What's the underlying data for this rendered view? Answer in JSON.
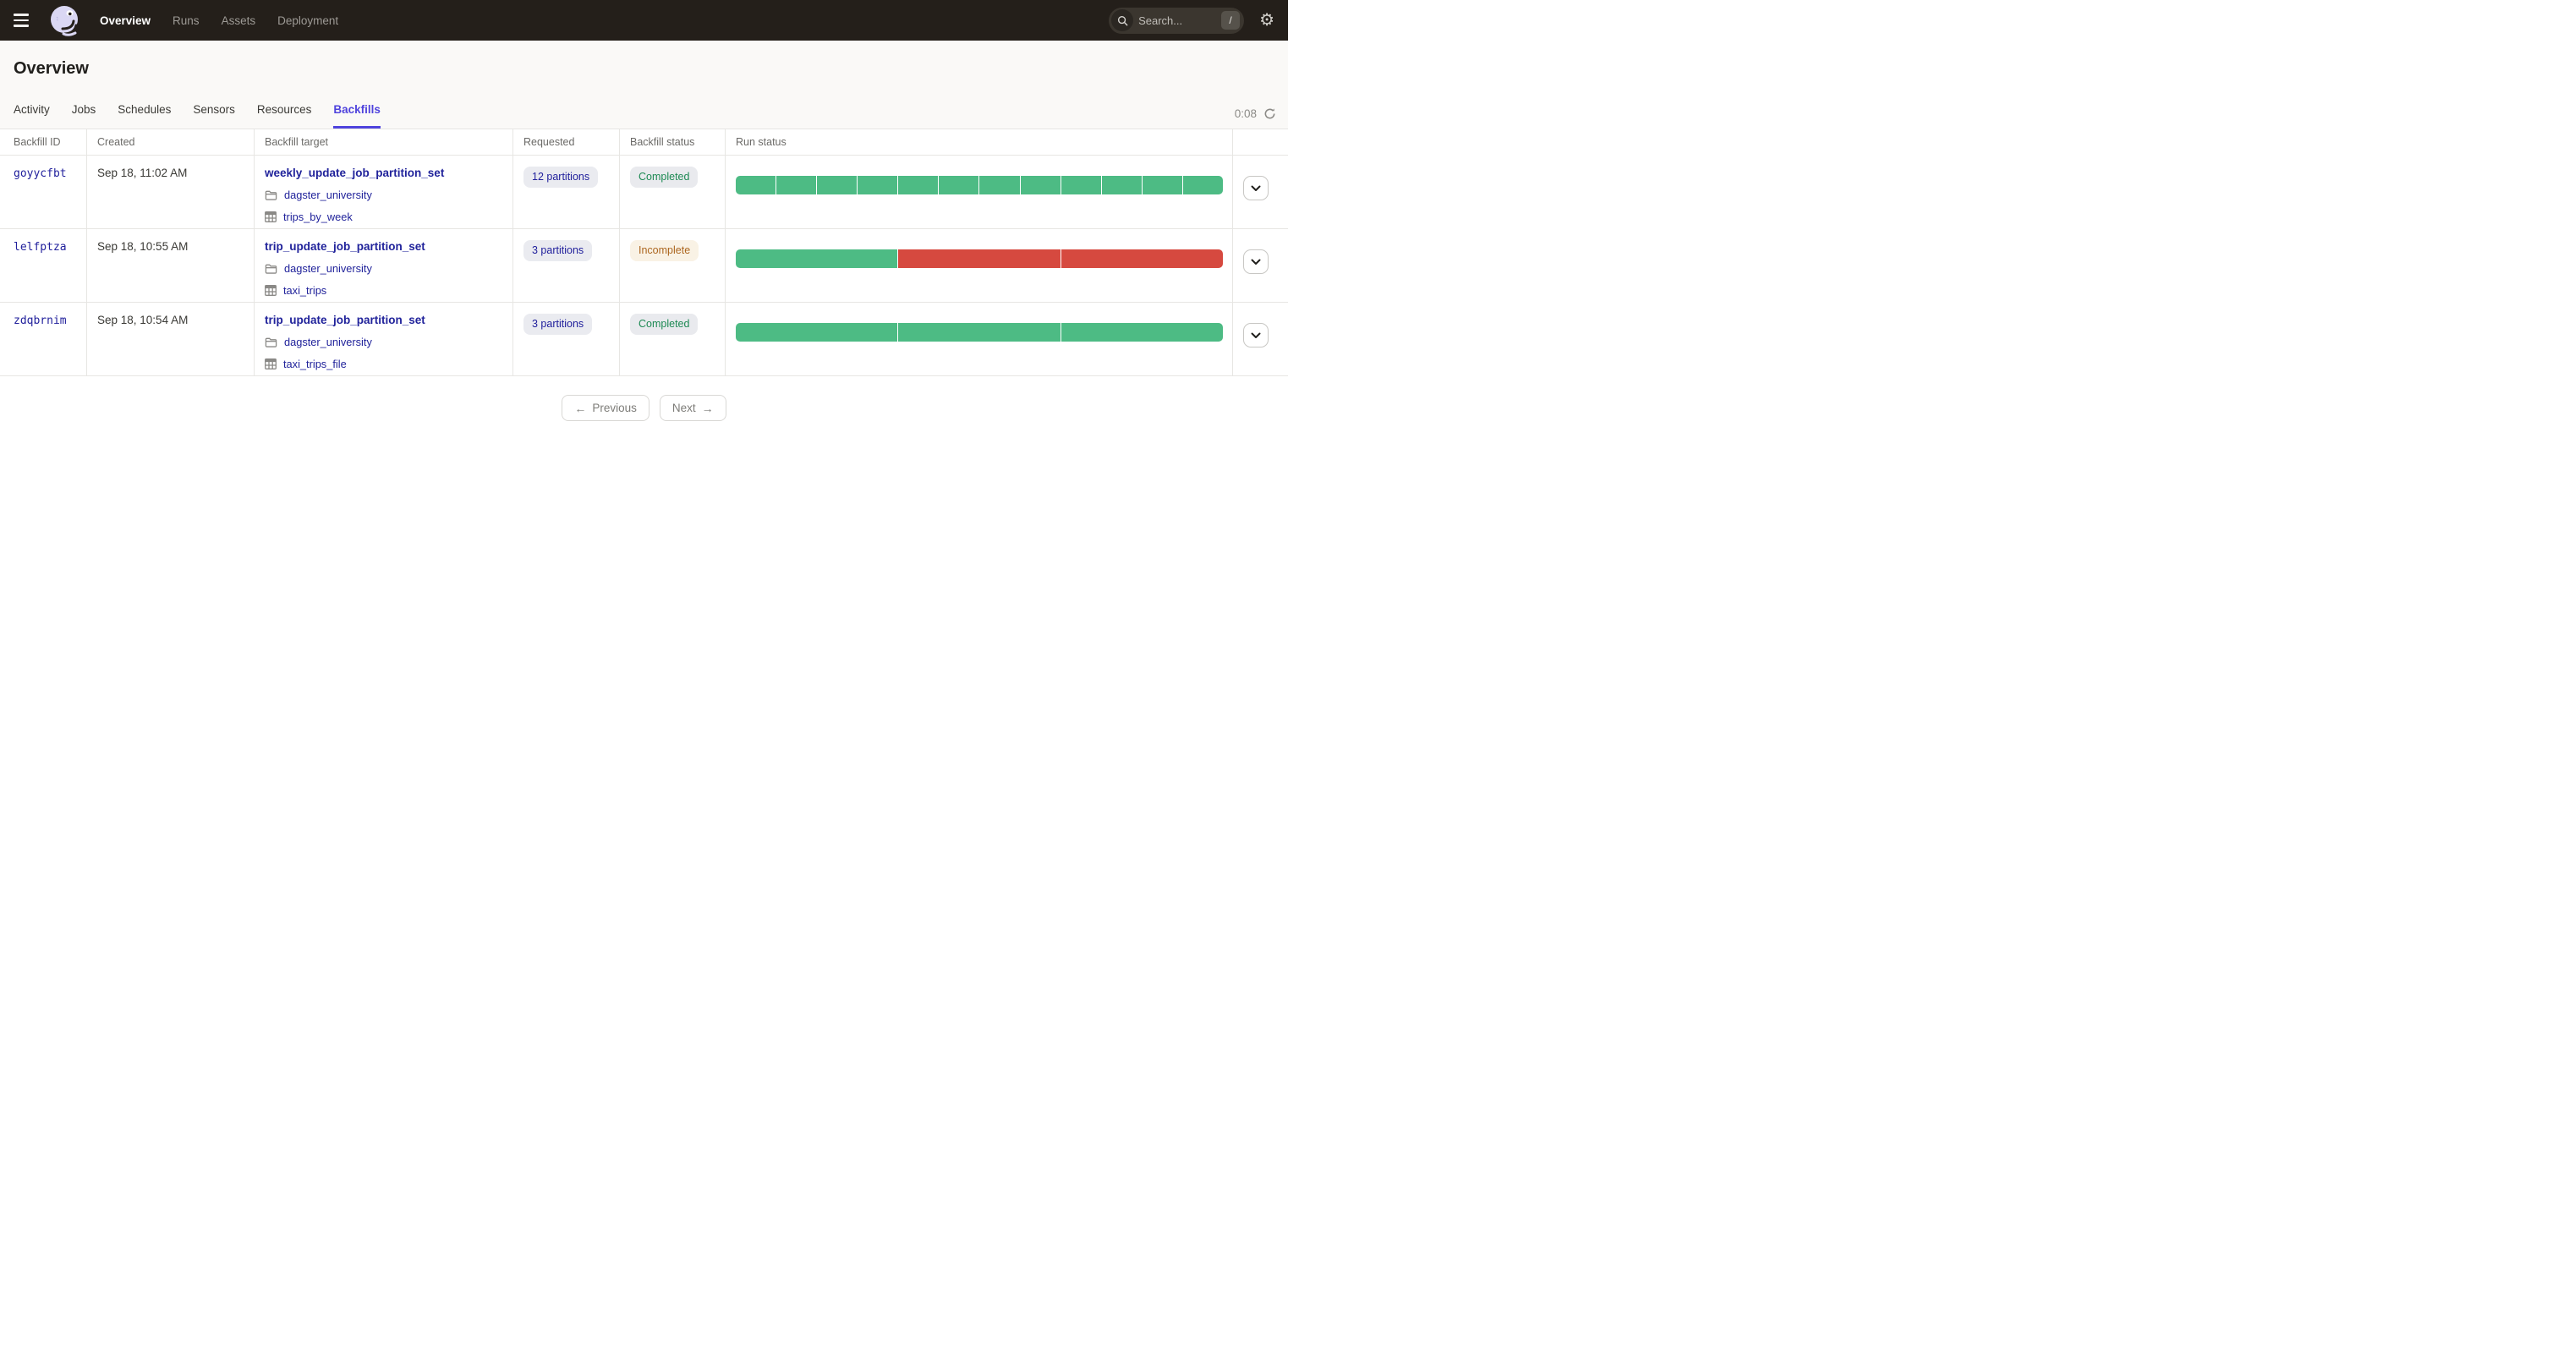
{
  "nav": {
    "logo_name": "dagster-logo",
    "items": [
      {
        "label": "Overview",
        "active": true
      },
      {
        "label": "Runs",
        "active": false
      },
      {
        "label": "Assets",
        "active": false
      },
      {
        "label": "Deployment",
        "active": false
      }
    ],
    "search": {
      "placeholder": "Search...",
      "shortcut": "/"
    }
  },
  "page": {
    "title": "Overview"
  },
  "tabs": {
    "items": [
      {
        "label": "Activity",
        "active": false
      },
      {
        "label": "Jobs",
        "active": false
      },
      {
        "label": "Schedules",
        "active": false
      },
      {
        "label": "Sensors",
        "active": false
      },
      {
        "label": "Resources",
        "active": false
      },
      {
        "label": "Backfills",
        "active": true
      }
    ],
    "refresh_timer": "0:08"
  },
  "table": {
    "columns": [
      "Backfill ID",
      "Created",
      "Backfill target",
      "Requested",
      "Backfill status",
      "Run status",
      ""
    ],
    "rows": [
      {
        "id": "goyycfbt",
        "created": "Sep 18, 11:02 AM",
        "target": "weekly_update_job_partition_set",
        "tags": [
          {
            "icon": "folder-icon",
            "label": "dagster_university"
          },
          {
            "icon": "table-grid-icon",
            "label": "trips_by_week"
          }
        ],
        "requested": "12 partitions",
        "status": {
          "label": "Completed",
          "tone": "success"
        },
        "run_segments": [
          "success",
          "success",
          "success",
          "success",
          "success",
          "success",
          "success",
          "success",
          "success",
          "success",
          "success",
          "success"
        ]
      },
      {
        "id": "lelfptza",
        "created": "Sep 18, 10:55 AM",
        "target": "trip_update_job_partition_set",
        "tags": [
          {
            "icon": "folder-icon",
            "label": "dagster_university"
          },
          {
            "icon": "table-grid-icon",
            "label": "taxi_trips"
          }
        ],
        "requested": "3 partitions",
        "status": {
          "label": "Incomplete",
          "tone": "warning"
        },
        "run_segments": [
          "success",
          "failure",
          "failure"
        ]
      },
      {
        "id": "zdqbrnim",
        "created": "Sep 18, 10:54 AM",
        "target": "trip_update_job_partition_set",
        "tags": [
          {
            "icon": "folder-icon",
            "label": "dagster_university"
          },
          {
            "icon": "table-grid-icon",
            "label": "taxi_trips_file"
          }
        ],
        "requested": "3 partitions",
        "status": {
          "label": "Completed",
          "tone": "success"
        },
        "run_segments": [
          "success",
          "success",
          "success"
        ]
      }
    ]
  },
  "pagination": {
    "previous_label": "Previous",
    "previous_arrow": "←",
    "next_label": "Next",
    "next_arrow": "→"
  },
  "colors": {
    "accent": "#4f43dd",
    "link": "#21239b",
    "run_success": "#4dbb84",
    "run_failure": "#d6493f",
    "status_success_text": "#1e8a54",
    "status_warning_text": "#ac661f",
    "nav_background": "#241f1a"
  }
}
